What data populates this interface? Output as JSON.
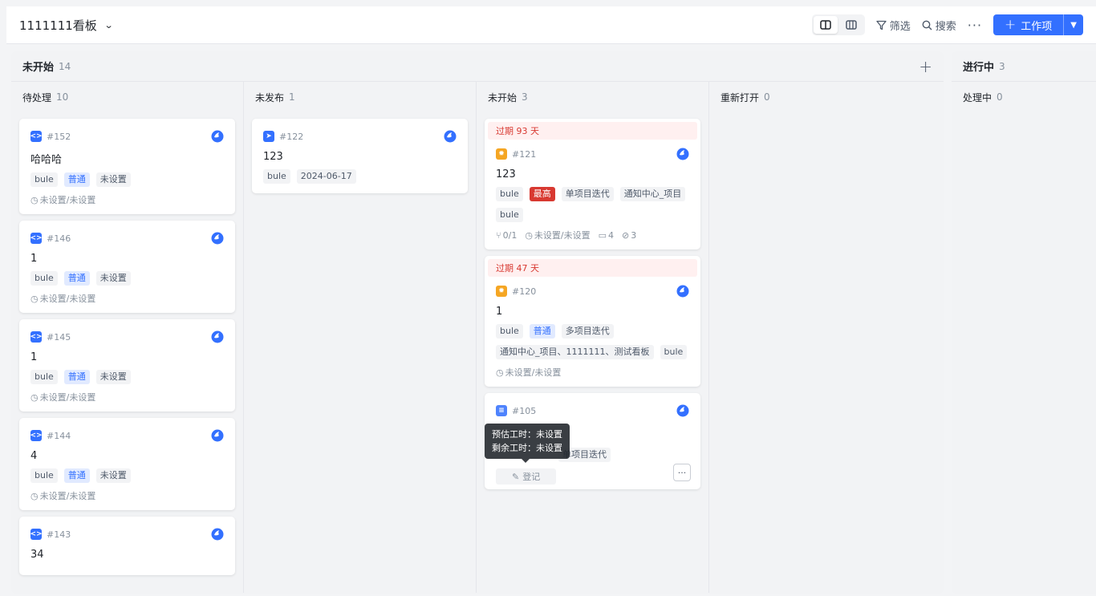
{
  "header": {
    "board_title": "1111111看板",
    "filter_label": "筛选",
    "search_label": "搜索",
    "new_item_label": "工作项"
  },
  "groups": [
    {
      "name": "未开始",
      "count": "14",
      "columns": [
        {
          "name": "待处理",
          "count": "10",
          "cards": [
            {
              "id": "#152",
              "title": "哈哈哈",
              "tags": [
                "bule",
                "普通",
                "未设置"
              ],
              "meta": "未设置/未设置"
            },
            {
              "id": "#146",
              "title": "1",
              "tags": [
                "bule",
                "普通",
                "未设置"
              ],
              "meta": "未设置/未设置"
            },
            {
              "id": "#145",
              "title": "1",
              "tags": [
                "bule",
                "普通",
                "未设置"
              ],
              "meta": "未设置/未设置"
            },
            {
              "id": "#144",
              "title": "4",
              "tags": [
                "bule",
                "普通",
                "未设置"
              ],
              "meta": "未设置/未设置"
            },
            {
              "id": "#143",
              "title": "34"
            }
          ]
        },
        {
          "name": "未发布",
          "count": "1",
          "cards": [
            {
              "id": "#122",
              "title": "123",
              "tags": [
                "bule",
                "2024-06-17"
              ]
            }
          ]
        },
        {
          "name": "未开始",
          "count": "3",
          "cards": [
            {
              "overdue": "过期 93 天",
              "id": "#121",
              "title": "123",
              "tags": [
                "bule",
                "最高",
                "单项目迭代",
                "通知中心_项目",
                "bule"
              ],
              "subtasks": "0/1",
              "meta": "未设置/未设置",
              "comments": "4",
              "attachments": "3"
            },
            {
              "overdue": "过期 47 天",
              "id": "#120",
              "title": "1",
              "tags": [
                "bule",
                "普通",
                "多项目迭代",
                "通知中心_项目、1111111、测试看板",
                "bule"
              ],
              "meta": "未设置/未设置"
            },
            {
              "id": "#105",
              "partial_tag": "单项目迭代",
              "tooltip_line1": "预估工时：未设置",
              "tooltip_line2": "剩余工时：未设置",
              "log_label": "登记"
            }
          ]
        },
        {
          "name": "重新打开",
          "count": "0",
          "cards": []
        }
      ]
    },
    {
      "name": "进行中",
      "count": "3",
      "columns": [
        {
          "name": "处理中",
          "count": "0"
        }
      ]
    }
  ]
}
